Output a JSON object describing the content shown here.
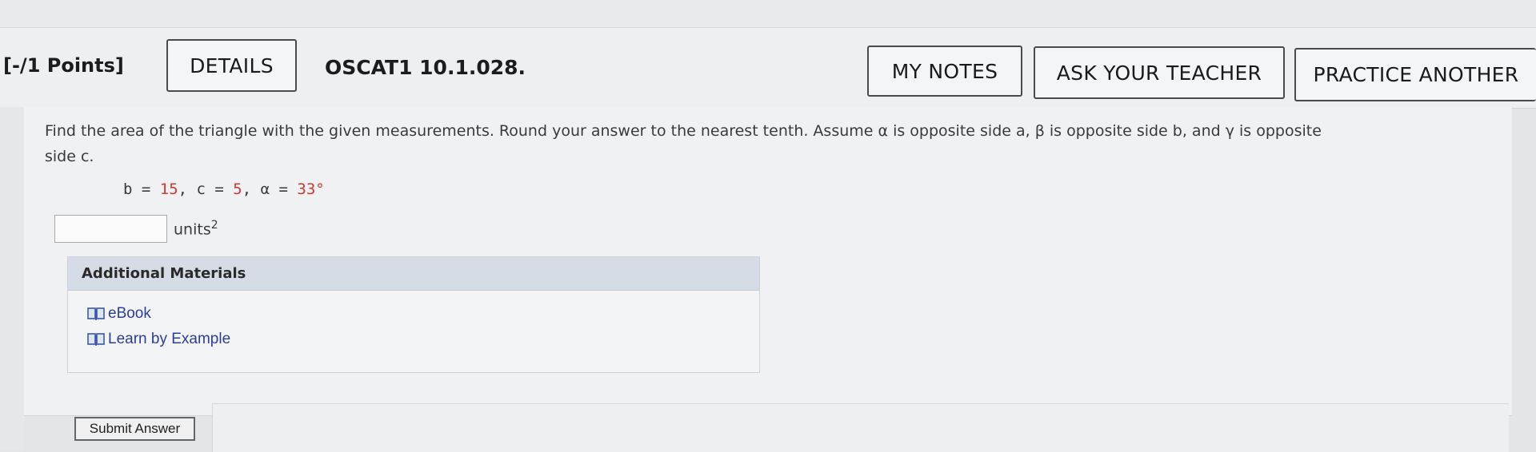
{
  "header": {
    "points": "[-/1 Points]",
    "details_label": "DETAILS",
    "question_id": "OSCAT1 10.1.028.",
    "my_notes_label": "MY NOTES",
    "ask_teacher_label": "ASK YOUR TEACHER",
    "practice_label": "PRACTICE ANOTHER"
  },
  "question": {
    "text_line1": "Find the area of the triangle with the given measurements. Round your answer to the nearest tenth. Assume α is opposite side a, β is opposite side b, and γ is opposite",
    "text_line2": "side c.",
    "given": {
      "b_label": "b = ",
      "b_value": "15",
      "c_label": ", c = ",
      "c_value": "5",
      "alpha_label": ", α = ",
      "alpha_value": "33°"
    },
    "answer_value": "",
    "units": "units",
    "units_exp": "2"
  },
  "additional_materials": {
    "title": "Additional Materials",
    "links": [
      {
        "label": "eBook",
        "icon": "book-icon"
      },
      {
        "label": "Learn by Example",
        "icon": "book-icon"
      }
    ]
  },
  "submit_label": "Submit Answer",
  "colors": {
    "value_red": "#d33a2c",
    "link_blue": "#2c3f95",
    "am_header": "#d6dce6"
  }
}
